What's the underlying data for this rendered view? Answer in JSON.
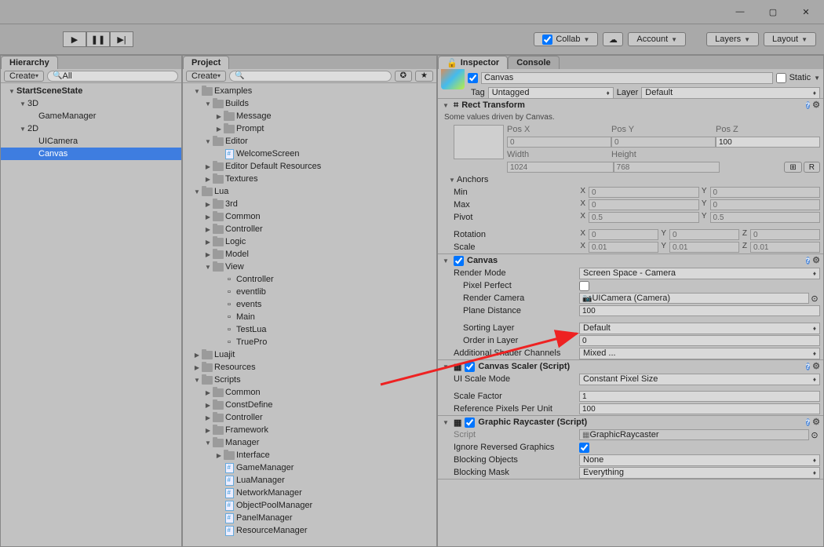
{
  "window_controls": {
    "min": "—",
    "max": "▢",
    "close": "✕"
  },
  "toolbar": {
    "play": "▶",
    "pause": "❚❚",
    "step": "▶|",
    "collab": "Collab",
    "account": "Account",
    "layers": "Layers",
    "layout": "Layout",
    "cloud": "☁"
  },
  "hierarchy": {
    "title": "Hierarchy",
    "create": "Create",
    "search": "All",
    "items": [
      {
        "label": "StartSceneState",
        "bold": true,
        "depth": 0,
        "fold": "▼"
      },
      {
        "label": "3D",
        "depth": 1,
        "fold": "▼"
      },
      {
        "label": "GameManager",
        "depth": 2
      },
      {
        "label": "2D",
        "depth": 1,
        "fold": "▼"
      },
      {
        "label": "UICamera",
        "depth": 2
      },
      {
        "label": "Canvas",
        "depth": 2,
        "sel": true
      }
    ]
  },
  "project": {
    "title": "Project",
    "create": "Create",
    "search": "",
    "items": [
      {
        "label": "Examples",
        "depth": 0,
        "fold": "▼",
        "icon": "folder"
      },
      {
        "label": "Builds",
        "depth": 1,
        "fold": "▼",
        "icon": "folder"
      },
      {
        "label": "Message",
        "depth": 2,
        "fold": "▶",
        "icon": "folder"
      },
      {
        "label": "Prompt",
        "depth": 2,
        "fold": "▶",
        "icon": "folder"
      },
      {
        "label": "Editor",
        "depth": 1,
        "fold": "▼",
        "icon": "folder"
      },
      {
        "label": "WelcomeScreen",
        "depth": 2,
        "icon": "cs"
      },
      {
        "label": "Editor Default Resources",
        "depth": 1,
        "fold": "▶",
        "icon": "folder"
      },
      {
        "label": "Textures",
        "depth": 1,
        "fold": "▶",
        "icon": "folder"
      },
      {
        "label": "Lua",
        "depth": 0,
        "fold": "▼",
        "icon": "folder"
      },
      {
        "label": "3rd",
        "depth": 1,
        "fold": "▶",
        "icon": "folder"
      },
      {
        "label": "Common",
        "depth": 1,
        "fold": "▶",
        "icon": "folder"
      },
      {
        "label": "Controller",
        "depth": 1,
        "fold": "▶",
        "icon": "folder"
      },
      {
        "label": "Logic",
        "depth": 1,
        "fold": "▶",
        "icon": "folder"
      },
      {
        "label": "Model",
        "depth": 1,
        "fold": "▶",
        "icon": "folder"
      },
      {
        "label": "View",
        "depth": 1,
        "fold": "▼",
        "icon": "folder"
      },
      {
        "label": "Controller",
        "depth": 2,
        "icon": "file"
      },
      {
        "label": "eventlib",
        "depth": 2,
        "icon": "file"
      },
      {
        "label": "events",
        "depth": 2,
        "icon": "file"
      },
      {
        "label": "Main",
        "depth": 2,
        "icon": "file"
      },
      {
        "label": "TestLua",
        "depth": 2,
        "icon": "file"
      },
      {
        "label": "TruePro",
        "depth": 2,
        "icon": "file"
      },
      {
        "label": "Luajit",
        "depth": 0,
        "fold": "▶",
        "icon": "folder"
      },
      {
        "label": "Resources",
        "depth": 0,
        "fold": "▶",
        "icon": "folder"
      },
      {
        "label": "Scripts",
        "depth": 0,
        "fold": "▼",
        "icon": "folder"
      },
      {
        "label": "Common",
        "depth": 1,
        "fold": "▶",
        "icon": "folder"
      },
      {
        "label": "ConstDefine",
        "depth": 1,
        "fold": "▶",
        "icon": "folder"
      },
      {
        "label": "Controller",
        "depth": 1,
        "fold": "▶",
        "icon": "folder"
      },
      {
        "label": "Framework",
        "depth": 1,
        "fold": "▶",
        "icon": "folder"
      },
      {
        "label": "Manager",
        "depth": 1,
        "fold": "▼",
        "icon": "folder"
      },
      {
        "label": "Interface",
        "depth": 2,
        "fold": "▶",
        "icon": "folder"
      },
      {
        "label": "GameManager",
        "depth": 2,
        "icon": "cs"
      },
      {
        "label": "LuaManager",
        "depth": 2,
        "icon": "cs"
      },
      {
        "label": "NetworkManager",
        "depth": 2,
        "icon": "cs"
      },
      {
        "label": "ObjectPoolManager",
        "depth": 2,
        "icon": "cs"
      },
      {
        "label": "PanelManager",
        "depth": 2,
        "icon": "cs"
      },
      {
        "label": "ResourceManager",
        "depth": 2,
        "icon": "cs"
      }
    ]
  },
  "inspector": {
    "title": "Inspector",
    "console": "Console",
    "go_name": "Canvas",
    "static": "Static",
    "tag_label": "Tag",
    "tag_val": "Untagged",
    "layer_label": "Layer",
    "layer_val": "Default",
    "rect": {
      "title": "Rect Transform",
      "note": "Some values driven by Canvas.",
      "posx_l": "Pos X",
      "posy_l": "Pos Y",
      "posz_l": "Pos Z",
      "posx": "0",
      "posy": "0",
      "posz": "100",
      "width_l": "Width",
      "height_l": "Height",
      "width": "1024",
      "height": "768",
      "anchors": "Anchors",
      "min": "Min",
      "max": "Max",
      "minx": "0",
      "miny": "0",
      "maxx": "0",
      "maxy": "0",
      "pivot": "Pivot",
      "pivotx": "0.5",
      "pivoty": "0.5",
      "rotation": "Rotation",
      "rx": "0",
      "ry": "0",
      "rz": "0",
      "scale": "Scale",
      "sx": "0.01",
      "sy": "0.01",
      "sz": "0.01",
      "r_btn": "R"
    },
    "canvas": {
      "title": "Canvas",
      "render_mode_l": "Render Mode",
      "render_mode": "Screen Space - Camera",
      "pixel_perfect_l": "Pixel Perfect",
      "render_camera_l": "Render Camera",
      "render_camera": "UICamera (Camera)",
      "plane_dist_l": "Plane Distance",
      "plane_dist": "100",
      "sorting_layer_l": "Sorting Layer",
      "sorting_layer": "Default",
      "order_l": "Order in Layer",
      "order": "0",
      "shader_l": "Additional Shader Channels",
      "shader": "Mixed ..."
    },
    "scaler": {
      "title": "Canvas Scaler (Script)",
      "mode_l": "UI Scale Mode",
      "mode": "Constant Pixel Size",
      "factor_l": "Scale Factor",
      "factor": "1",
      "ref_l": "Reference Pixels Per Unit",
      "ref": "100"
    },
    "raycaster": {
      "title": "Graphic Raycaster (Script)",
      "script_l": "Script",
      "script": "GraphicRaycaster",
      "ignore_l": "Ignore Reversed Graphics",
      "block_obj_l": "Blocking Objects",
      "block_obj": "None",
      "block_mask_l": "Blocking Mask",
      "block_mask": "Everything"
    }
  }
}
